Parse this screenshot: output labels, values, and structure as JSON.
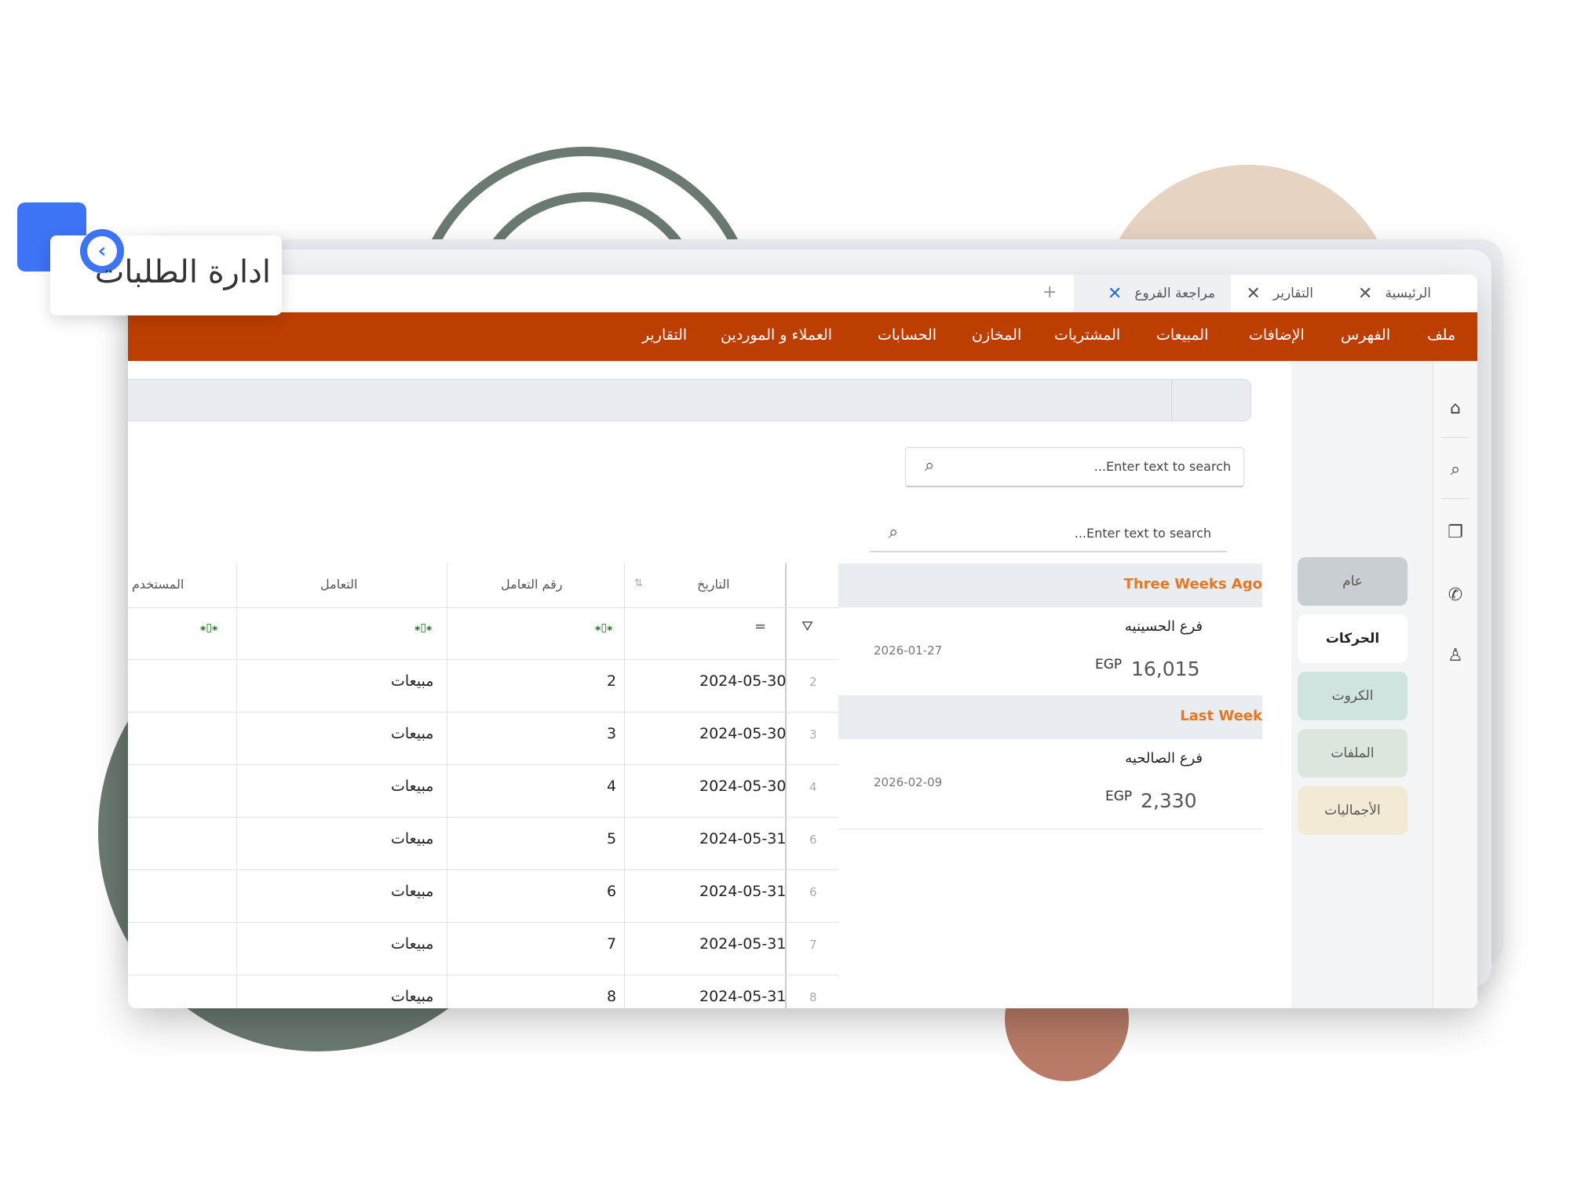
{
  "badge": {
    "title": "ادارة الطلبات"
  },
  "tabs": [
    {
      "label": "الرئيسية",
      "active": false
    },
    {
      "label": "التقارير",
      "active": false
    },
    {
      "label": "مراجعة الفروع",
      "active": true
    }
  ],
  "tab_add": "+",
  "menu": [
    "ملف",
    "الفهرس",
    "الإضافات",
    "المبيعات",
    "المشتريات",
    "المخازن",
    "الحسابات",
    "العملاء و الموردين",
    "التقارير"
  ],
  "icons": [
    "home-icon",
    "search-icon",
    "documents-icon",
    "whatsapp-icon",
    "user-icon"
  ],
  "nav": [
    {
      "label": "عام",
      "color": "#c9ced3"
    },
    {
      "label": "الحركات",
      "color": "#ffffff"
    },
    {
      "label": "الكروت",
      "color": "#cfe3df"
    },
    {
      "label": "الملفات",
      "color": "#dde6dc"
    },
    {
      "label": "الأجماليات",
      "color": "#f3ead6"
    }
  ],
  "search_placeholder": "...Enter text to search",
  "groups": [
    {
      "header": "Three Weeks Ago",
      "branch": "فرع الحسينيه",
      "date": "2026-01-27",
      "currency": "EGP",
      "amount": "16,015"
    },
    {
      "header": "Last Week",
      "branch": "فرع الصالحيه",
      "date": "2026-02-09",
      "currency": "EGP",
      "amount": "2,330"
    }
  ],
  "table": {
    "headers": {
      "date": "التاريخ",
      "number": "رقم التعامل",
      "type": "التعامل",
      "user": "المستخدم"
    },
    "filter_icons": {
      "eq": "=",
      "contains": "⁎▯⁎"
    },
    "rows": [
      {
        "idx": "2",
        "date": "2024-05-30",
        "number": "2",
        "type": "مبيعات"
      },
      {
        "idx": "3",
        "date": "2024-05-30",
        "number": "3",
        "type": "مبيعات"
      },
      {
        "idx": "4",
        "date": "2024-05-30",
        "number": "4",
        "type": "مبيعات"
      },
      {
        "idx": "6",
        "date": "2024-05-31",
        "number": "5",
        "type": "مبيعات"
      },
      {
        "idx": "6",
        "date": "2024-05-31",
        "number": "6",
        "type": "مبيعات"
      },
      {
        "idx": "7",
        "date": "2024-05-31",
        "number": "7",
        "type": "مبيعات"
      },
      {
        "idx": "8",
        "date": "2024-05-31",
        "number": "8",
        "type": "مبيعات"
      }
    ]
  },
  "colors": {
    "menu_bar": "#bd3e01",
    "accent_orange": "#e87720",
    "tab_close_active": "#1f6fd8",
    "badge_blue": "#3d73f5"
  }
}
